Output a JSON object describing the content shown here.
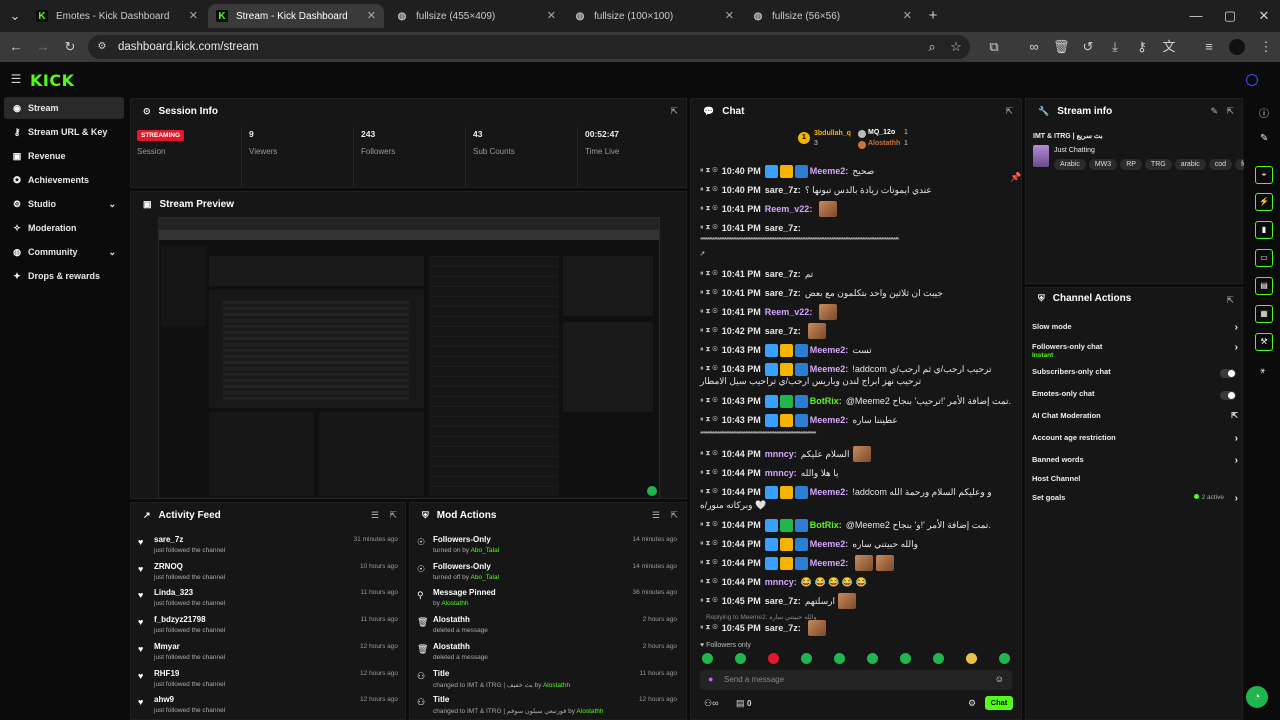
{
  "browser": {
    "tabs": [
      {
        "title": "Emotes - Kick Dashboard"
      },
      {
        "title": "Stream - Kick Dashboard"
      },
      {
        "title": "fullsize (455×409)"
      },
      {
        "title": "fullsize (100×100)"
      },
      {
        "title": "fullsize (56×56)"
      }
    ],
    "url": "dashboard.kick.com/stream"
  },
  "sidebar": {
    "items": [
      {
        "label": "Stream"
      },
      {
        "label": "Stream URL & Key"
      },
      {
        "label": "Revenue"
      },
      {
        "label": "Achievements"
      },
      {
        "label": "Studio"
      },
      {
        "label": "Moderation"
      },
      {
        "label": "Community"
      },
      {
        "label": "Drops & rewards"
      }
    ]
  },
  "session": {
    "title": "Session Info",
    "status_badge": "STREAMING",
    "stats": [
      {
        "value": "",
        "label": "Session"
      },
      {
        "value": "9",
        "label": "Viewers"
      },
      {
        "value": "243",
        "label": "Followers"
      },
      {
        "value": "43",
        "label": "Sub Counts"
      },
      {
        "value": "00:52:47",
        "label": "Time Live"
      }
    ]
  },
  "preview": {
    "title": "Stream Preview"
  },
  "activity": {
    "title": "Activity Feed",
    "items": [
      {
        "name": "sare_7z",
        "sub": "just followed the channel",
        "time": "31 minutes ago"
      },
      {
        "name": "ZRNOQ",
        "sub": "just followed the channel",
        "time": "10 hours ago"
      },
      {
        "name": "Linda_323",
        "sub": "just followed the channel",
        "time": "11 hours ago"
      },
      {
        "name": "f_bdzyz21798",
        "sub": "just followed the channel",
        "time": "11 hours ago"
      },
      {
        "name": "Mmyar",
        "sub": "just followed the channel",
        "time": "12 hours ago"
      },
      {
        "name": "RHF19",
        "sub": "just followed the channel",
        "time": "12 hours ago"
      },
      {
        "name": "ahw9",
        "sub": "just followed the channel",
        "time": "12 hours ago"
      }
    ]
  },
  "mod": {
    "title": "Mod Actions",
    "items": [
      {
        "name": "Followers-Only",
        "sub": "turned on by",
        "who": "Abo_Talal",
        "time": "14 minutes ago"
      },
      {
        "name": "Followers-Only",
        "sub": "turned off by",
        "who": "Abo_Talal",
        "time": "14 minutes ago"
      },
      {
        "name": "Message Pinned",
        "sub": "by",
        "who": "Alostathh",
        "time": "36 minutes ago"
      },
      {
        "name": "Alostathh",
        "sub": "deleted a message",
        "who": "",
        "time": "2 hours ago"
      },
      {
        "name": "Alostathh",
        "sub": "deleted a message",
        "who": "",
        "time": "2 hours ago"
      },
      {
        "name": "Title",
        "sub": "changed to IMT & ITRG | بث خفيف by",
        "who": "Alostathh",
        "time": "11 hours ago"
      },
      {
        "name": "Title",
        "sub": "changed to IMT & ITRG | فورتبعي سيلون سوقم by",
        "who": "Alostathh",
        "time": "12 hours ago"
      }
    ]
  },
  "chat": {
    "title": "Chat",
    "top_gifters": [
      {
        "name": "3bdullah_q",
        "count": "3"
      },
      {
        "name": "MQ_12o",
        "count": "1"
      },
      {
        "name": "Alostathh",
        "count": "1"
      }
    ],
    "messages": [
      {
        "time": "10:40 PM",
        "user": "Meeme2:",
        "color": "#d7a6ff",
        "text": "صحيح"
      },
      {
        "time": "10:40 PM",
        "user": "sare_7z:",
        "color": "#e6e6e6",
        "text": "عندي ايموتات زيادة بالدس تبونها ؟"
      },
      {
        "time": "10:41 PM",
        "user": "Reem_v22:",
        "color": "#d7a6ff",
        "text": ""
      },
      {
        "time": "10:41 PM",
        "user": "sare_7z:",
        "color": "#e6e6e6",
        "text": ""
      },
      {
        "time": "10:41 PM",
        "user": "sare_7z:",
        "color": "#e6e6e6",
        "text": "تم"
      },
      {
        "time": "10:41 PM",
        "user": "sare_7z:",
        "color": "#e6e6e6",
        "text": "جيبت ان ثلاثين واحد بتكلمون مع بعض"
      },
      {
        "time": "10:41 PM",
        "user": "Reem_v22:",
        "color": "#d7a6ff",
        "text": ""
      },
      {
        "time": "10:42 PM",
        "user": "sare_7z:",
        "color": "#e6e6e6",
        "text": ""
      },
      {
        "time": "10:43 PM",
        "user": "Meeme2:",
        "color": "#d7a6ff",
        "text": "تست"
      },
      {
        "time": "10:43 PM",
        "user": "Meeme2:",
        "color": "#d7a6ff",
        "text": "!addcom ترحيب ارحب/ي ثم ارحب/ي"
      },
      {
        "time": "10:43 PM",
        "user": "BotRix:",
        "color": "#53fc18",
        "text": "@Meeme2 تمت إضافة الأمر '!ترحيب' بنجاح."
      },
      {
        "time": "10:43 PM",
        "user": "Meeme2:",
        "color": "#d7a6ff",
        "text": "عطيننا ساره"
      },
      {
        "time": "10:44 PM",
        "user": "mnncy:",
        "color": "#d7a6ff",
        "text": "السلام عليكم"
      },
      {
        "time": "10:44 PM",
        "user": "mnncy:",
        "color": "#d7a6ff",
        "text": "يا هلا والله"
      },
      {
        "time": "10:44 PM",
        "user": "Meeme2:",
        "color": "#d7a6ff",
        "text": "!addcom و وعليكم السلام ورحمة الله"
      },
      {
        "time": "10:44 PM",
        "user": "BotRix:",
        "color": "#53fc18",
        "text": "@Meeme2 تمت إضافة الأمر '!و' بنجاح."
      },
      {
        "time": "10:44 PM",
        "user": "Meeme2:",
        "color": "#d7a6ff",
        "text": "والله حبيتني ساره"
      },
      {
        "time": "10:44 PM",
        "user": "Meeme2:",
        "color": "#d7a6ff",
        "text": ""
      },
      {
        "time": "10:44 PM",
        "user": "mnncy:",
        "color": "#d7a6ff",
        "text": "😂 😂 😂 😂 😂"
      },
      {
        "time": "10:45 PM",
        "user": "sare_7z:",
        "color": "#e6e6e6",
        "text": "ارسلتهم"
      },
      {
        "time": "10:45 PM",
        "user": "sare_7z:",
        "color": "#e6e6e6",
        "text": ""
      }
    ],
    "wrap1": "ترحيب نهز ابراج لندن وباريس ارحب/ي تراحيب سيل الامطار",
    "wrap2": "وبركاته منور/ه",
    "reply": "Replying to Meeme2: والله حبيتني ساره",
    "followers_only": "Followers only",
    "placeholder": "Send a message",
    "count": "0",
    "send": "Chat"
  },
  "stream_info": {
    "title": "Stream info",
    "stream_title": "IMT & ITRG | بث سريع",
    "category": "Just Chatting",
    "tags": [
      "Arabic",
      "MW3",
      "RP",
      "TRG",
      "arabic",
      "cod",
      "fc26"
    ]
  },
  "channel_actions": {
    "title": "Channel Actions",
    "items": [
      {
        "label": "Slow mode",
        "sub": "",
        "kind": "chevron"
      },
      {
        "label": "Followers-only chat",
        "sub": "Instant",
        "kind": "chevron"
      },
      {
        "label": "Subscribers-only chat",
        "sub": "",
        "kind": "toggle"
      },
      {
        "label": "Emotes-only chat",
        "sub": "",
        "kind": "toggle"
      },
      {
        "label": "AI Chat Moderation",
        "sub": "",
        "kind": "external"
      },
      {
        "label": "Account age restriction",
        "sub": "",
        "kind": "chevron"
      },
      {
        "label": "Banned words",
        "sub": "",
        "kind": "chevron"
      },
      {
        "label": "Host Channel",
        "sub": "",
        "kind": "none"
      },
      {
        "label": "Set goals",
        "sub": "2 active",
        "kind": "chevron"
      }
    ]
  },
  "colors": {
    "brand": "#53fc18",
    "live": "#e0192d",
    "bg": "#0b0b0b",
    "panel": "#161616"
  }
}
